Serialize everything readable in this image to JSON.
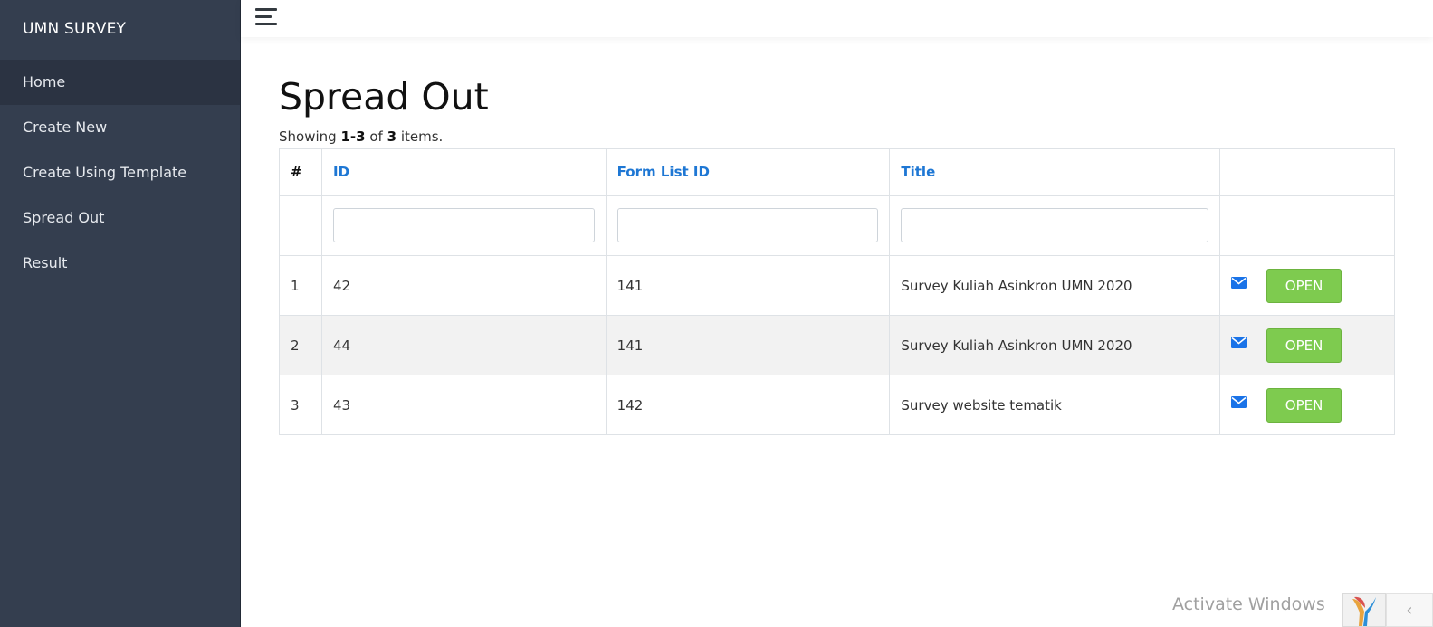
{
  "app": {
    "brand": "UMN SURVEY"
  },
  "sidebar": {
    "items": [
      {
        "label": "Home"
      },
      {
        "label": "Create New"
      },
      {
        "label": "Create Using Template"
      },
      {
        "label": "Spread Out"
      },
      {
        "label": "Result"
      }
    ]
  },
  "page": {
    "title": "Spread Out",
    "summary": {
      "prefix": "Showing",
      "range": "1-3",
      "of": "of",
      "total": "3",
      "suffix": "items."
    }
  },
  "table": {
    "headers": {
      "num": "#",
      "id": "ID",
      "form_list_id": "Form List ID",
      "title": "Title",
      "actions": ""
    },
    "filters": {
      "id": "",
      "form_list_id": "",
      "title": ""
    },
    "rows": [
      {
        "num": "1",
        "id": "42",
        "form_list_id": "141",
        "title": "Survey Kuliah Asinkron UMN 2020",
        "action": "OPEN"
      },
      {
        "num": "2",
        "id": "44",
        "form_list_id": "141",
        "title": "Survey Kuliah Asinkron UMN 2020",
        "action": "OPEN"
      },
      {
        "num": "3",
        "id": "43",
        "form_list_id": "142",
        "title": "Survey website tematik",
        "action": "OPEN"
      }
    ]
  },
  "icons": {
    "menu": "hamburger-icon",
    "mail": "envelope-icon",
    "logo": "yii-logo-icon",
    "collapse": "chevron-left-icon"
  },
  "colors": {
    "sidebar": "#343e4f",
    "link": "#1e77d4",
    "open_button": "#7ecb4f",
    "mail_icon": "#1a73e8"
  },
  "overlay": {
    "watermark": "Activate Windows",
    "collapse_glyph": "‹"
  }
}
